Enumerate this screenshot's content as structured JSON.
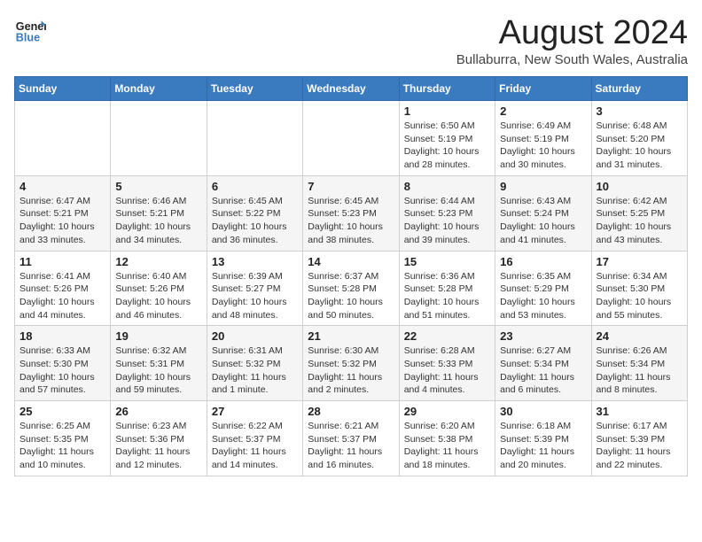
{
  "header": {
    "logo_line1": "General",
    "logo_line2": "Blue",
    "title": "August 2024",
    "subtitle": "Bullaburra, New South Wales, Australia"
  },
  "weekdays": [
    "Sunday",
    "Monday",
    "Tuesday",
    "Wednesday",
    "Thursday",
    "Friday",
    "Saturday"
  ],
  "weeks": [
    [
      {
        "day": "",
        "info": ""
      },
      {
        "day": "",
        "info": ""
      },
      {
        "day": "",
        "info": ""
      },
      {
        "day": "",
        "info": ""
      },
      {
        "day": "1",
        "info": "Sunrise: 6:50 AM\nSunset: 5:19 PM\nDaylight: 10 hours and 28 minutes."
      },
      {
        "day": "2",
        "info": "Sunrise: 6:49 AM\nSunset: 5:19 PM\nDaylight: 10 hours and 30 minutes."
      },
      {
        "day": "3",
        "info": "Sunrise: 6:48 AM\nSunset: 5:20 PM\nDaylight: 10 hours and 31 minutes."
      }
    ],
    [
      {
        "day": "4",
        "info": "Sunrise: 6:47 AM\nSunset: 5:21 PM\nDaylight: 10 hours and 33 minutes."
      },
      {
        "day": "5",
        "info": "Sunrise: 6:46 AM\nSunset: 5:21 PM\nDaylight: 10 hours and 34 minutes."
      },
      {
        "day": "6",
        "info": "Sunrise: 6:45 AM\nSunset: 5:22 PM\nDaylight: 10 hours and 36 minutes."
      },
      {
        "day": "7",
        "info": "Sunrise: 6:45 AM\nSunset: 5:23 PM\nDaylight: 10 hours and 38 minutes."
      },
      {
        "day": "8",
        "info": "Sunrise: 6:44 AM\nSunset: 5:23 PM\nDaylight: 10 hours and 39 minutes."
      },
      {
        "day": "9",
        "info": "Sunrise: 6:43 AM\nSunset: 5:24 PM\nDaylight: 10 hours and 41 minutes."
      },
      {
        "day": "10",
        "info": "Sunrise: 6:42 AM\nSunset: 5:25 PM\nDaylight: 10 hours and 43 minutes."
      }
    ],
    [
      {
        "day": "11",
        "info": "Sunrise: 6:41 AM\nSunset: 5:26 PM\nDaylight: 10 hours and 44 minutes."
      },
      {
        "day": "12",
        "info": "Sunrise: 6:40 AM\nSunset: 5:26 PM\nDaylight: 10 hours and 46 minutes."
      },
      {
        "day": "13",
        "info": "Sunrise: 6:39 AM\nSunset: 5:27 PM\nDaylight: 10 hours and 48 minutes."
      },
      {
        "day": "14",
        "info": "Sunrise: 6:37 AM\nSunset: 5:28 PM\nDaylight: 10 hours and 50 minutes."
      },
      {
        "day": "15",
        "info": "Sunrise: 6:36 AM\nSunset: 5:28 PM\nDaylight: 10 hours and 51 minutes."
      },
      {
        "day": "16",
        "info": "Sunrise: 6:35 AM\nSunset: 5:29 PM\nDaylight: 10 hours and 53 minutes."
      },
      {
        "day": "17",
        "info": "Sunrise: 6:34 AM\nSunset: 5:30 PM\nDaylight: 10 hours and 55 minutes."
      }
    ],
    [
      {
        "day": "18",
        "info": "Sunrise: 6:33 AM\nSunset: 5:30 PM\nDaylight: 10 hours and 57 minutes."
      },
      {
        "day": "19",
        "info": "Sunrise: 6:32 AM\nSunset: 5:31 PM\nDaylight: 10 hours and 59 minutes."
      },
      {
        "day": "20",
        "info": "Sunrise: 6:31 AM\nSunset: 5:32 PM\nDaylight: 11 hours and 1 minute."
      },
      {
        "day": "21",
        "info": "Sunrise: 6:30 AM\nSunset: 5:32 PM\nDaylight: 11 hours and 2 minutes."
      },
      {
        "day": "22",
        "info": "Sunrise: 6:28 AM\nSunset: 5:33 PM\nDaylight: 11 hours and 4 minutes."
      },
      {
        "day": "23",
        "info": "Sunrise: 6:27 AM\nSunset: 5:34 PM\nDaylight: 11 hours and 6 minutes."
      },
      {
        "day": "24",
        "info": "Sunrise: 6:26 AM\nSunset: 5:34 PM\nDaylight: 11 hours and 8 minutes."
      }
    ],
    [
      {
        "day": "25",
        "info": "Sunrise: 6:25 AM\nSunset: 5:35 PM\nDaylight: 11 hours and 10 minutes."
      },
      {
        "day": "26",
        "info": "Sunrise: 6:23 AM\nSunset: 5:36 PM\nDaylight: 11 hours and 12 minutes."
      },
      {
        "day": "27",
        "info": "Sunrise: 6:22 AM\nSunset: 5:37 PM\nDaylight: 11 hours and 14 minutes."
      },
      {
        "day": "28",
        "info": "Sunrise: 6:21 AM\nSunset: 5:37 PM\nDaylight: 11 hours and 16 minutes."
      },
      {
        "day": "29",
        "info": "Sunrise: 6:20 AM\nSunset: 5:38 PM\nDaylight: 11 hours and 18 minutes."
      },
      {
        "day": "30",
        "info": "Sunrise: 6:18 AM\nSunset: 5:39 PM\nDaylight: 11 hours and 20 minutes."
      },
      {
        "day": "31",
        "info": "Sunrise: 6:17 AM\nSunset: 5:39 PM\nDaylight: 11 hours and 22 minutes."
      }
    ]
  ],
  "colors": {
    "header_bg": "#3a7abf",
    "logo_blue": "#3a7abf"
  }
}
